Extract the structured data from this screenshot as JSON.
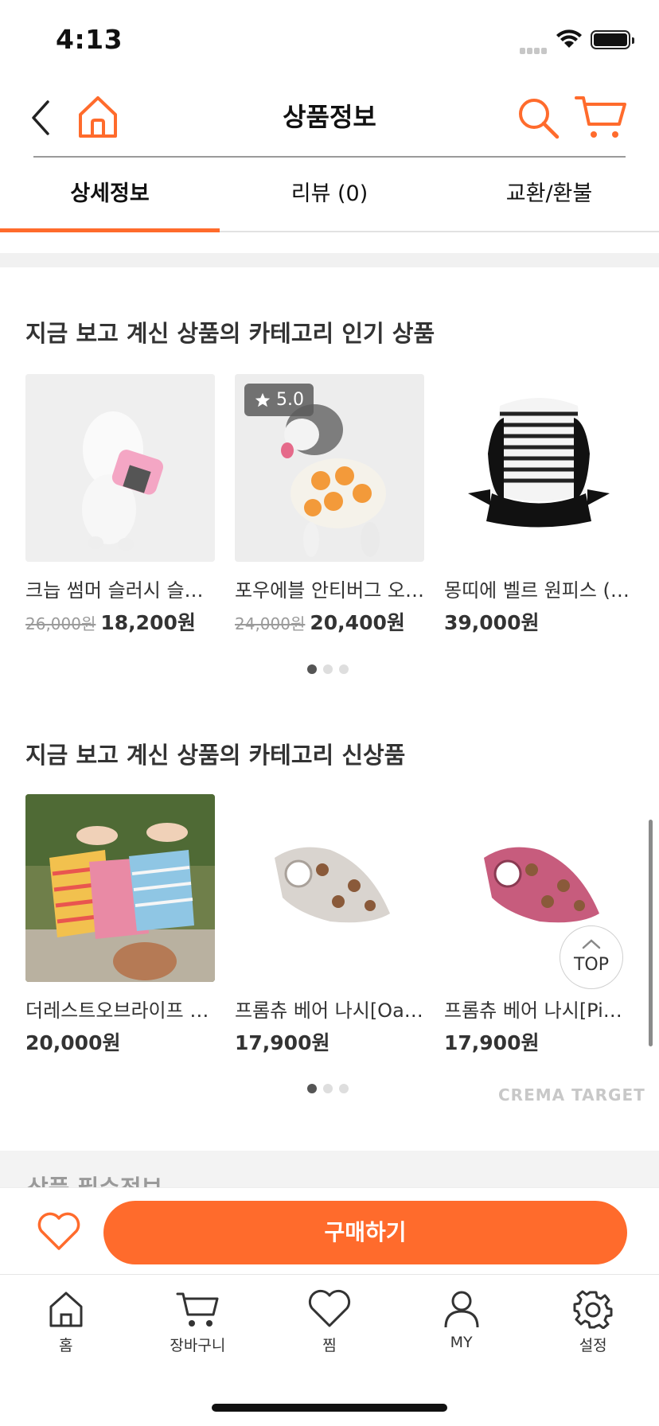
{
  "status_bar": {
    "time": "4:13"
  },
  "header": {
    "title": "상품정보"
  },
  "tabs": [
    {
      "label": "상세정보",
      "active": true
    },
    {
      "label": "리뷰 (0)",
      "active": false
    },
    {
      "label": "교환/환불",
      "active": false
    }
  ],
  "popular": {
    "title": "지금 보고 계신 상품의 카테고리 인기 상품",
    "products": [
      {
        "name": "크늡 썸머 슬러시 슬리브",
        "original_price": "26,000원",
        "price": "18,200원"
      },
      {
        "name": "포우에블 안티버그 오렌지",
        "original_price": "24,000원",
        "price": "20,400원",
        "rating": "5.0"
      },
      {
        "name": "몽띠에 벨르 원피스 (블랙)",
        "original_price": "",
        "price": "39,000원"
      }
    ],
    "page_count": 3,
    "active_page": 1
  },
  "new_arrivals": {
    "title": "지금 보고 계신 상품의 카테고리 신상품",
    "products": [
      {
        "name": "더레스트오브라이프 나시",
        "price": "20,000원"
      },
      {
        "name": "프롬츄 베어 나시[Oatmeal]",
        "price": "17,900원"
      },
      {
        "name": "프롬츄 베어 나시[Pink]",
        "price": "17,900원"
      }
    ],
    "page_count": 3,
    "active_page": 1
  },
  "crema_label": "CREMA TARGET",
  "top_button": "TOP",
  "next_section_peek": "상품 필수정보",
  "buy_bar": {
    "buy_label": "구매하기"
  },
  "tabbar": [
    {
      "label": "홈",
      "icon": "home-icon"
    },
    {
      "label": "장바구니",
      "icon": "cart-icon"
    },
    {
      "label": "찜",
      "icon": "heart-icon"
    },
    {
      "label": "MY",
      "icon": "person-icon"
    },
    {
      "label": "설정",
      "icon": "gear-icon"
    }
  ],
  "colors": {
    "accent": "#ff6b2c",
    "text": "#333333"
  }
}
